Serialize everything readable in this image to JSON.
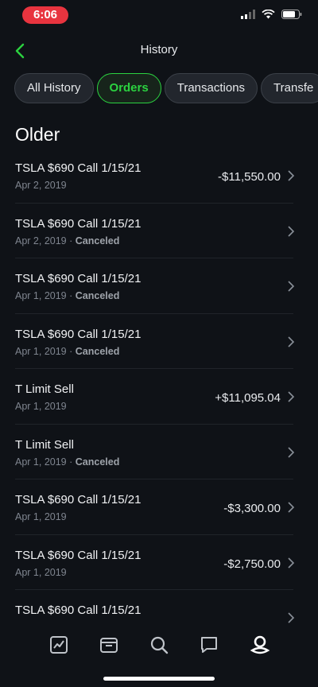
{
  "status": {
    "time": "6:06"
  },
  "header": {
    "title": "History"
  },
  "tabs": [
    {
      "label": "All History",
      "active": false
    },
    {
      "label": "Orders",
      "active": true
    },
    {
      "label": "Transactions",
      "active": false
    },
    {
      "label": "Transfe",
      "active": false
    }
  ],
  "section": {
    "title": "Older"
  },
  "orders": [
    {
      "title": "TSLA $690 Call 1/15/21",
      "date": "Apr 2, 2019",
      "status": "",
      "amount": "-$11,550.00"
    },
    {
      "title": "TSLA $690 Call 1/15/21",
      "date": "Apr 2, 2019",
      "status": "Canceled",
      "amount": ""
    },
    {
      "title": "TSLA $690 Call 1/15/21",
      "date": "Apr 1, 2019",
      "status": "Canceled",
      "amount": ""
    },
    {
      "title": "TSLA $690 Call 1/15/21",
      "date": "Apr 1, 2019",
      "status": "Canceled",
      "amount": ""
    },
    {
      "title": "T Limit Sell",
      "date": "Apr 1, 2019",
      "status": "",
      "amount": "+$11,095.04"
    },
    {
      "title": "T Limit Sell",
      "date": "Apr 1, 2019",
      "status": "Canceled",
      "amount": ""
    },
    {
      "title": "TSLA $690 Call 1/15/21",
      "date": "Apr 1, 2019",
      "status": "",
      "amount": "-$3,300.00"
    },
    {
      "title": "TSLA $690 Call 1/15/21",
      "date": "Apr 1, 2019",
      "status": "",
      "amount": "-$2,750.00"
    },
    {
      "title": "TSLA $690 Call 1/15/21",
      "date": "",
      "status": "",
      "amount": ""
    }
  ],
  "bottom_nav": [
    {
      "icon": "chart-icon"
    },
    {
      "icon": "wallet-icon"
    },
    {
      "icon": "search-icon"
    },
    {
      "icon": "chat-icon"
    },
    {
      "icon": "account-icon"
    }
  ],
  "colors": {
    "accent": "#2bd240",
    "background": "#0f1217",
    "status_pill": "#e8343f"
  }
}
